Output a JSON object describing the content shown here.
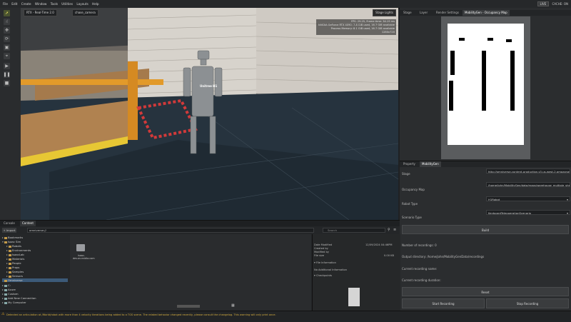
{
  "menu": [
    "File",
    "Edit",
    "Create",
    "Window",
    "Tools",
    "Utilities",
    "Layouts",
    "Help"
  ],
  "top_right": {
    "live_label": "LIVE",
    "cache_label": "CACHE: ON"
  },
  "viewport": {
    "tab_renderer": "RTX - Real-Time 2.0",
    "tab_camera": "chase_camera",
    "stage_lights": "Stage Lights",
    "stats": [
      "FPS: 29.25, Frame time: 34.19 ms",
      "NVIDIA GeForce RTX 4090: 7.8 GiB used, 16.7 GiB available",
      "Process Memory: 8.1 GiB used, 16.7 GiB available",
      "1280x720"
    ],
    "robot_label": "Unitree H1"
  },
  "right_tabs": [
    "Stage",
    "Layer",
    "Render Settings",
    "MobilityGen - Occupancy Map"
  ],
  "props_tabs": [
    "Property",
    "MobilityGen"
  ],
  "props": {
    "stage_label": "Stage",
    "stage_value": "http://omniverse-content-production.s3-us-west-2.amazonaws.com",
    "occupancy_label": "Occupancy Map",
    "occupancy_value": "/home/john/MobilityGen/data/maps/warehouse_multiple_shelves",
    "robot_type_label": "Robot Type",
    "robot_type_value": "H1Robot",
    "scenario_label": "Scenario Type",
    "scenario_value": "KeyboardTeleoperationScenario",
    "build_label": "Build",
    "recordings_label": "Number of recordings: 0",
    "output_label": "Output directory: /home/john/MobilityGenData/recordings",
    "current_name_label": "Current recording name:",
    "current_duration_label": "Current recording duration:",
    "reset_label": "Reset",
    "start_label": "Start Recording",
    "stop_label": "Stop Recording"
  },
  "content_tabs": [
    "Console",
    "Content"
  ],
  "content": {
    "import_label": "+ Import",
    "path_value": "omniverse://",
    "search_placeholder": "Search",
    "tree": [
      {
        "label": "Bookmarks",
        "indent": 0
      },
      {
        "label": "Isaac Sim",
        "indent": 0
      },
      {
        "label": "Robots",
        "indent": 1
      },
      {
        "label": "Environments",
        "indent": 1
      },
      {
        "label": "IsaacLab",
        "indent": 1
      },
      {
        "label": "Materials",
        "indent": 1
      },
      {
        "label": "People",
        "indent": 1
      },
      {
        "label": "Props",
        "indent": 1
      },
      {
        "label": "Samples",
        "indent": 1
      },
      {
        "label": "Sensors",
        "indent": 1
      },
      {
        "label": "Omniverse",
        "indent": 0
      },
      {
        "label": "C:",
        "indent": 0
      },
      {
        "label": "Azure",
        "indent": 0
      },
      {
        "label": "Custom",
        "indent": 0
      },
      {
        "label": "Add New Connection",
        "indent": 0
      },
      {
        "label": "My Computer",
        "indent": 0
      }
    ],
    "grid_item": "isaac-dev.ov.nvidia.com",
    "info": {
      "date_modified_label": "Date Modified",
      "date_modified_value": "12/09/2024 04:46PM",
      "created_by_label": "Created by",
      "modified_by_label": "Modified by",
      "file_size_label": "File size",
      "file_size_value": "0.00 KB",
      "file_info_label": "File Information",
      "no_info_label": "No Additional Information",
      "checkpoints_label": "Checkpoints"
    }
  },
  "status": "Detected an articulation at /World/robot with more than 4 velocity iterations being added to a TGS scene. The related behavior changed recently, please consult the changelog. This warning will only print once."
}
